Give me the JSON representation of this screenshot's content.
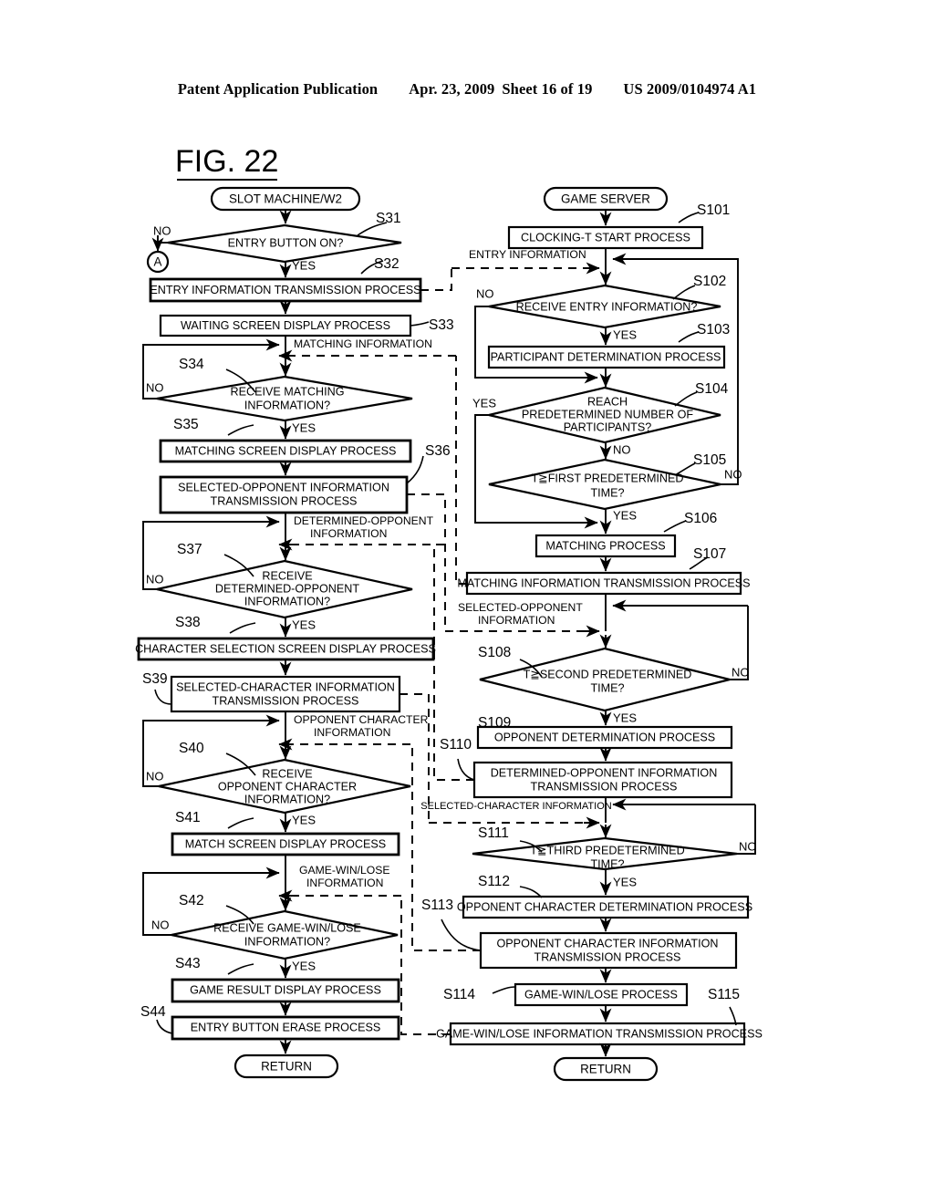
{
  "header": {
    "publication": "Patent Application Publication",
    "date": "Apr. 23, 2009",
    "sheet": "Sheet 16 of 19",
    "number": "US 2009/0104974 A1"
  },
  "figure": {
    "label": "FIG. 22"
  },
  "left_column": {
    "title": "SLOT MACHINE/W2",
    "connector": "A",
    "nodes": [
      {
        "id": "S31",
        "type": "decision",
        "text": "ENTRY BUTTON ON?",
        "yes": "YES",
        "no": "NO"
      },
      {
        "id": "S32",
        "type": "process",
        "text": "ENTRY INFORMATION TRANSMISSION PROCESS"
      },
      {
        "id": "S33",
        "type": "process",
        "text": "WAITING SCREEN DISPLAY PROCESS"
      },
      {
        "id": "S34",
        "type": "decision",
        "text_l1": "RECEIVE MATCHING",
        "text_l2": "INFORMATION?",
        "yes": "YES",
        "no": "NO"
      },
      {
        "id": "S35",
        "type": "process",
        "text": "MATCHING SCREEN DISPLAY PROCESS"
      },
      {
        "id": "S36",
        "type": "process",
        "text_l1": "SELECTED-OPPONENT INFORMATION",
        "text_l2": "TRANSMISSION PROCESS"
      },
      {
        "id": "S37",
        "type": "decision",
        "text_l1": "RECEIVE",
        "text_l2": "DETERMINED-OPPONENT",
        "text_l3": "INFORMATION?",
        "yes": "YES",
        "no": "NO"
      },
      {
        "id": "S38",
        "type": "process",
        "text": "CHARACTER SELECTION SCREEN DISPLAY PROCESS"
      },
      {
        "id": "S39",
        "type": "process",
        "text_l1": "SELECTED-CHARACTER INFORMATION",
        "text_l2": "TRANSMISSION PROCESS"
      },
      {
        "id": "S40",
        "type": "decision",
        "text_l1": "RECEIVE",
        "text_l2": "OPPONENT CHARACTER",
        "text_l3": "INFORMATION?",
        "yes": "YES",
        "no": "NO"
      },
      {
        "id": "S41",
        "type": "process",
        "text": "MATCH SCREEN DISPLAY PROCESS"
      },
      {
        "id": "S42",
        "type": "decision",
        "text_l1": "RECEIVE GAME-WIN/LOSE",
        "text_l2": "INFORMATION?",
        "yes": "YES",
        "no": "NO"
      },
      {
        "id": "S43",
        "type": "process",
        "text": "GAME RESULT DISPLAY PROCESS"
      },
      {
        "id": "S44",
        "type": "process",
        "text": "ENTRY BUTTON ERASE PROCESS"
      }
    ],
    "end": "RETURN"
  },
  "right_column": {
    "title": "GAME SERVER",
    "nodes": [
      {
        "id": "S101",
        "type": "process",
        "text": "CLOCKING-T START PROCESS"
      },
      {
        "id": "S102",
        "type": "decision",
        "text": "RECEIVE ENTRY INFORMATION?",
        "yes": "YES",
        "no": "NO"
      },
      {
        "id": "S103",
        "type": "process",
        "text": "PARTICIPANT DETERMINATION PROCESS"
      },
      {
        "id": "S104",
        "type": "decision",
        "text_l1": "REACH",
        "text_l2": "PREDETERMINED NUMBER OF",
        "text_l3": "PARTICIPANTS?",
        "yes": "YES",
        "no": "NO"
      },
      {
        "id": "S105",
        "type": "decision",
        "text_l1": "T≧FIRST PREDETERMINED",
        "text_l2": "TIME?",
        "yes": "YES",
        "no": "NO"
      },
      {
        "id": "S106",
        "type": "process",
        "text": "MATCHING PROCESS"
      },
      {
        "id": "S107",
        "type": "process",
        "text": "MATCHING INFORMATION TRANSMISSION PROCESS"
      },
      {
        "id": "S108",
        "type": "decision",
        "text_l1": "T≧SECOND PREDETERMINED",
        "text_l2": "TIME?",
        "yes": "YES",
        "no": "NO"
      },
      {
        "id": "S109",
        "type": "process",
        "text": "OPPONENT DETERMINATION PROCESS"
      },
      {
        "id": "S110",
        "type": "process",
        "text_l1": "DETERMINED-OPPONENT INFORMATION",
        "text_l2": "TRANSMISSION PROCESS"
      },
      {
        "id": "S111",
        "type": "decision",
        "text_l1": "T≧THIRD PREDETERMINED",
        "text_l2": "TIME?",
        "yes": "YES",
        "no": "NO"
      },
      {
        "id": "S112",
        "type": "process",
        "text": "OPPONENT CHARACTER DETERMINATION PROCESS"
      },
      {
        "id": "S113",
        "type": "process",
        "text_l1": "OPPONENT CHARACTER INFORMATION",
        "text_l2": "TRANSMISSION PROCESS"
      },
      {
        "id": "S114",
        "type": "process",
        "text": "GAME-WIN/LOSE PROCESS"
      },
      {
        "id": "S115",
        "type": "process",
        "text": "GAME-WIN/LOSE INFORMATION TRANSMISSION PROCESS"
      }
    ],
    "end": "RETURN"
  },
  "signals": {
    "entry_information": "ENTRY INFORMATION",
    "matching_information": "MATCHING INFORMATION",
    "selected_opponent_l1": "SELECTED-OPPONENT",
    "selected_opponent_l2": "INFORMATION",
    "determined_opponent_l1": "DETERMINED-OPPONENT",
    "determined_opponent_l2": "INFORMATION",
    "opponent_character_l1": "OPPONENT CHARACTER",
    "opponent_character_l2": "INFORMATION",
    "selected_character": "SELECTED-CHARACTER INFORMATION",
    "game_win_lose_l1": "GAME-WIN/LOSE",
    "game_win_lose_l2": "INFORMATION"
  },
  "colors": {
    "ink": "#000000",
    "paper": "#ffffff"
  }
}
